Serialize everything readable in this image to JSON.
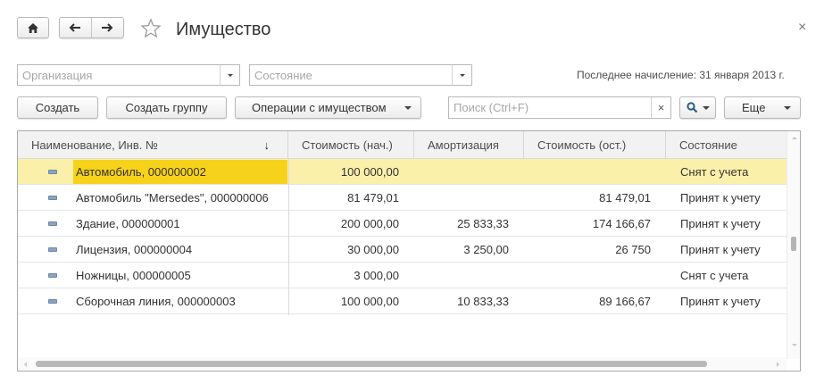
{
  "window": {
    "title": "Имущество",
    "close_glyph": "×"
  },
  "nav": {
    "home_icon": "home-icon",
    "back_icon": "arrow-left-icon",
    "forward_icon": "arrow-right-icon",
    "favorite_icon": "star-outline-icon"
  },
  "filters": {
    "organization_placeholder": "Организация",
    "state_placeholder": "Состояние",
    "last_accrual": "Последнее начисление: 31 января 2013 г."
  },
  "toolbar": {
    "create": "Создать",
    "create_group": "Создать группу",
    "operations": "Операции с имуществом",
    "search_placeholder": "Поиск (Ctrl+F)",
    "search_clear": "×",
    "more": "Еще"
  },
  "table": {
    "columns": [
      "Наименование, Инв. №",
      "Стоимость (нач.)",
      "Амортизация",
      "Стоимость (ост.)",
      "Состояние"
    ],
    "sort_indicator": "↓",
    "rows": [
      {
        "name": "Автомобиль, 000000002",
        "cost_initial": "100 000,00",
        "amortization": "",
        "cost_residual": "",
        "state": "Снят с учета",
        "selected": true
      },
      {
        "name": "Автомобиль \"Mersedes\", 000000006",
        "cost_initial": "81 479,01",
        "amortization": "",
        "cost_residual": "81 479,01",
        "state": "Принят к учету",
        "selected": false
      },
      {
        "name": "Здание, 000000001",
        "cost_initial": "200 000,00",
        "amortization": "25 833,33",
        "cost_residual": "174 166,67",
        "state": "Принят к учету",
        "selected": false
      },
      {
        "name": "Лицензия, 000000004",
        "cost_initial": "30 000,00",
        "amortization": "3 250,00",
        "cost_residual": "26 750",
        "state": "Принят к учету",
        "selected": false
      },
      {
        "name": "Ножницы, 000000005",
        "cost_initial": "3 000,00",
        "amortization": "",
        "cost_residual": "",
        "state": "Снят с учета",
        "selected": false
      },
      {
        "name": "Сборочная линия, 000000003",
        "cost_initial": "100 000,00",
        "amortization": "10 833,33",
        "cost_residual": "89 166,67",
        "state": "Принят к учету",
        "selected": false
      }
    ]
  },
  "colors": {
    "selected_row": "#fbf0a9",
    "selected_cell": "#f7d21a",
    "header_bg": "#f2f2f2",
    "border": "#b9b9b9"
  }
}
